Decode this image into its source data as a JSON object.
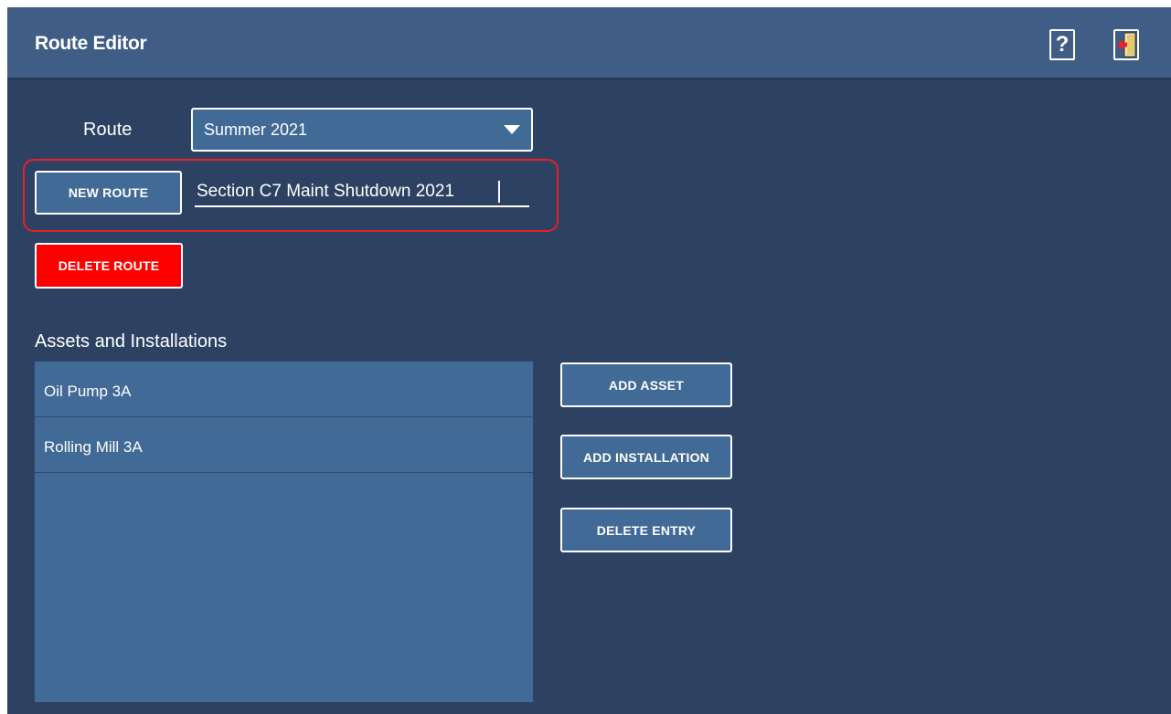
{
  "header": {
    "title": "Route Editor",
    "help_label": "?"
  },
  "route": {
    "label": "Route",
    "selected": "Summer 2021"
  },
  "new_route": {
    "button_label": "NEW ROUTE",
    "input_value": "Section C7 Maint Shutdown 2021"
  },
  "delete_route": {
    "button_label": "DELETE ROUTE",
    "color": "#ff0000"
  },
  "assets": {
    "section_label": "Assets and Installations",
    "items": [
      {
        "label": "Oil Pump 3A"
      },
      {
        "label": "Rolling  Mill 3A"
      }
    ]
  },
  "actions": {
    "add_asset": "ADD ASSET",
    "add_installation": "ADD INSTALLATION",
    "delete_entry": "DELETE ENTRY"
  },
  "colors": {
    "background": "#2d4262",
    "header": "#3f5d85",
    "panel": "#416a96",
    "highlight": "#e8202a"
  },
  "icons": {
    "help": "help-icon",
    "exit": "exit-door-icon"
  }
}
